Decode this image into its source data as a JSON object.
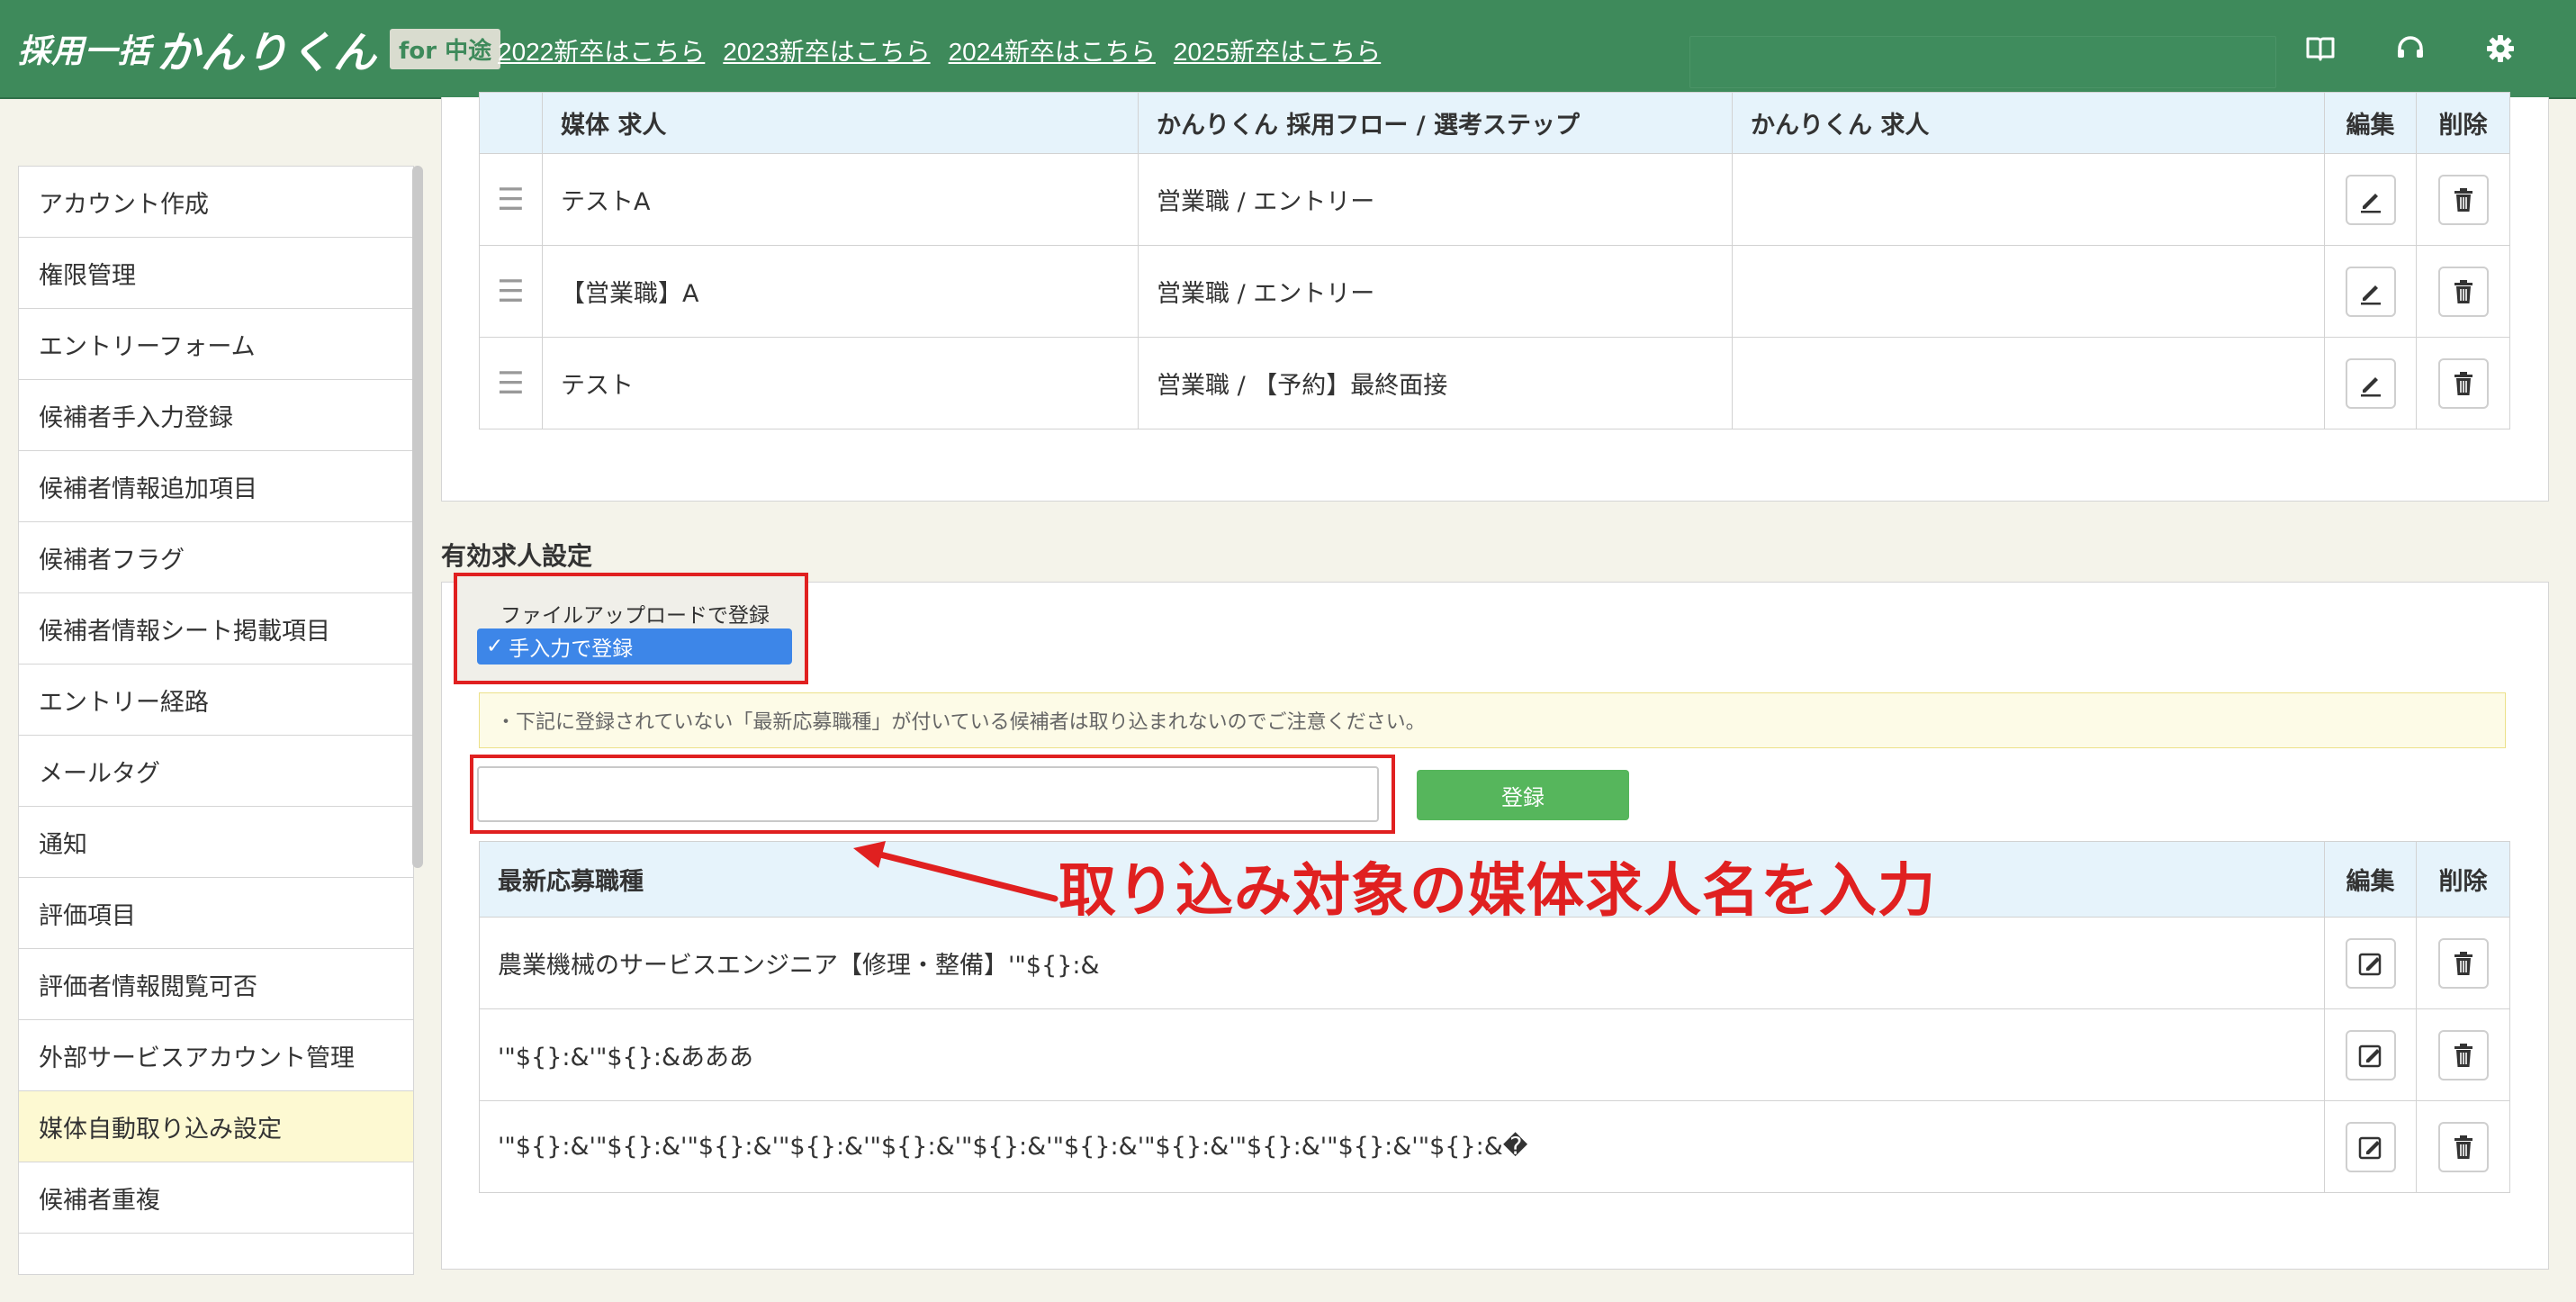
{
  "header": {
    "logo_main": "採用一括",
    "logo_brand": "かんりくん",
    "logo_tag": "for 中途",
    "links": [
      "2022新卒はこちら",
      "2023新卒はこちら",
      "2024新卒はこちら",
      "2025新卒はこちら"
    ],
    "icons": [
      "book-icon",
      "headset-icon",
      "gear-icon"
    ],
    "color": "#3e8a5b"
  },
  "sidebar": {
    "items": [
      "アカウント作成",
      "権限管理",
      "エントリーフォーム",
      "候補者手入力登録",
      "候補者情報追加項目",
      "候補者フラグ",
      "候補者情報シート掲載項目",
      "エントリー経路",
      "メールタグ",
      "通知",
      "評価項目",
      "評価者情報閲覧可否",
      "外部サービスアカウント管理",
      "媒体自動取り込み設定",
      "候補者重複"
    ],
    "active": "媒体自動取り込み設定"
  },
  "mapping_table": {
    "headers": [
      "",
      "媒体 求人",
      "かんりくん 採用フロー / 選考ステップ",
      "かんりくん 求人",
      "編集",
      "削除"
    ],
    "rows": [
      {
        "media_job": "テストA",
        "flow": "営業職 / エントリー",
        "job": ""
      },
      {
        "media_job": "【営業職】A",
        "flow": "営業職 / エントリー",
        "job": ""
      },
      {
        "media_job": "テスト",
        "flow": "営業職 / 【予約】最終面接",
        "job": ""
      }
    ]
  },
  "valid_jobs": {
    "title": "有効求人設定",
    "dropdown_options": [
      "ファイルアップロードで登録",
      "手入力で登録"
    ],
    "dropdown_selected": "手入力で登録",
    "check_mark": "✓",
    "notice": "・下記に登録されていない「最新応募職種」が付いている候補者は取り込まれないのでご注意ください。",
    "input_value": "",
    "register_label": "登録",
    "headers": [
      "最新応募職種",
      "編集",
      "削除"
    ],
    "rows": [
      "農業機械のサービスエンジニア【修理・整備】'\"${}:&",
      "'\"${}:&'\"${}:&あああ",
      "'\"${}:&'\"${}:&'\"${}:&'\"${}:&'\"${}:&'\"${}:&'\"${}:&'\"${}:&'\"${}:&'\"${}:&'\"${}:&�"
    ]
  },
  "annotation": {
    "text": "取り込み対象の媒体求人名を入力",
    "color": "#e02020"
  }
}
